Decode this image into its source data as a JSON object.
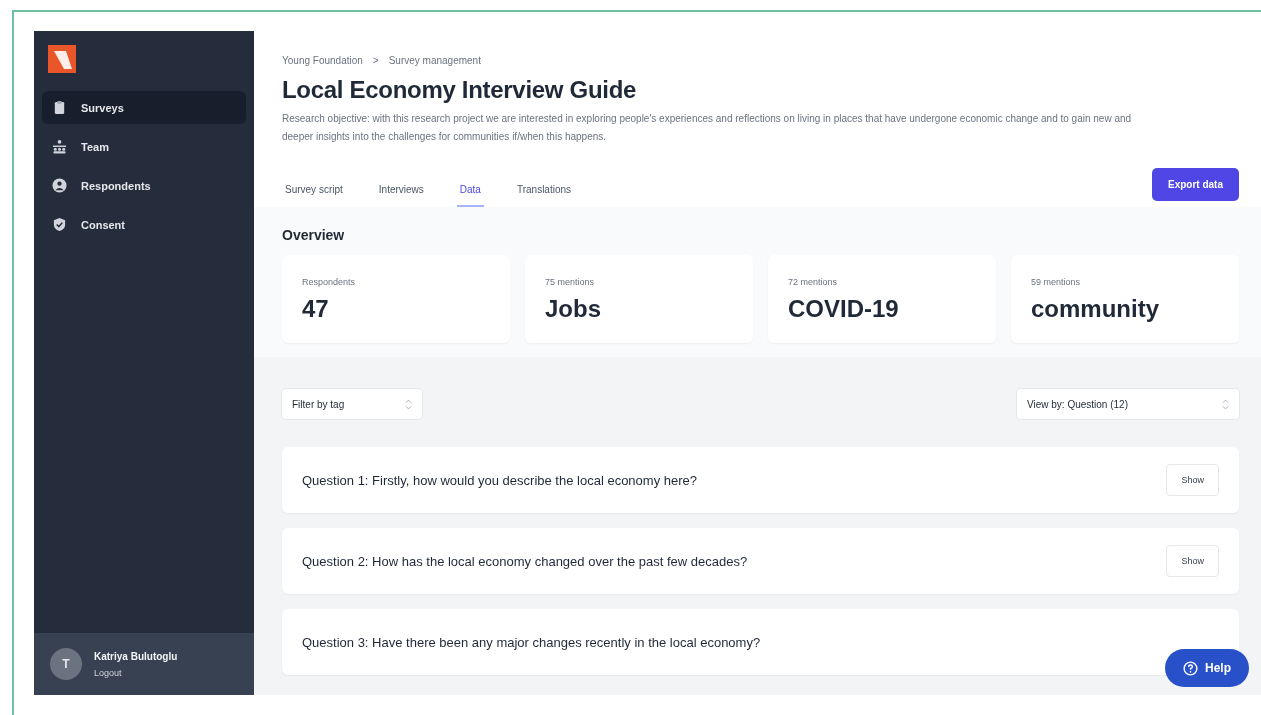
{
  "sidebar": {
    "items": [
      {
        "label": "Surveys",
        "selected": true
      },
      {
        "label": "Team",
        "selected": false
      },
      {
        "label": "Respondents",
        "selected": false
      },
      {
        "label": "Consent",
        "selected": false
      }
    ],
    "user": {
      "initial": "T",
      "name": "Katriya Bulutoglu",
      "action": "Logout"
    }
  },
  "breadcrumb": [
    "Young Foundation",
    "Survey management"
  ],
  "breadcrumb_separator": ">",
  "title": "Local Economy Interview Guide",
  "description": "Research objective: with this research project we are interested in exploring people's experiences and reflections on living in places that have undergone economic change and to gain new and deeper insights into the challenges for communities if/when this happens.",
  "tabs": [
    {
      "label": "Survey script",
      "selected": false
    },
    {
      "label": "Interviews",
      "selected": false
    },
    {
      "label": "Data",
      "selected": true
    },
    {
      "label": "Translations",
      "selected": false
    }
  ],
  "export_button": "Export data",
  "overview": {
    "title": "Overview",
    "stats": [
      {
        "label": "Respondents",
        "value": "47"
      },
      {
        "label": "75 mentions",
        "value": "Jobs"
      },
      {
        "label": "72 mentions",
        "value": "COVID-19"
      },
      {
        "label": "59 mentions",
        "value": "community"
      }
    ]
  },
  "filter": {
    "value": "Filter by tag"
  },
  "view_by": {
    "value": "View by: Question (12)"
  },
  "questions": [
    {
      "text": "Question 1: Firstly, how would you describe the local economy here?",
      "button": "Show"
    },
    {
      "text": "Question 2: How has the local economy changed over the past few decades?",
      "button": "Show"
    },
    {
      "text": "Question 3: Have there been any major changes recently in the local economy?"
    }
  ],
  "help_button": "Help"
}
